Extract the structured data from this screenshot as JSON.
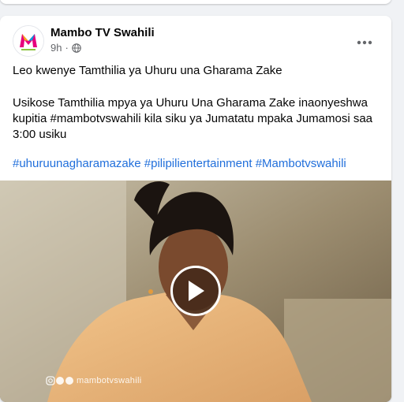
{
  "post": {
    "author": "Mambo TV Swahili",
    "time": "9h",
    "separator": "·",
    "avatar_icon": "mambo-tv-logo",
    "privacy_icon": "globe-icon",
    "menu_icon": "more-horizontal-icon",
    "lines": {
      "intro": "Leo kwenye Tamthilia ya Uhuru una Gharama Zake",
      "body": "Usikose Tamthilia mpya ya Uhuru Una Gharama Zake inaonyeshwa kupitia #mambotvswahili kila siku ya Jumatatu mpaka Jumamosi saa 3:00 usiku",
      "hashtags": "#uhuruunagharamazake #pilipilientertainment #Mambotvswahili"
    },
    "video": {
      "watermark": "mambotvswahili",
      "play_icon": "play-icon"
    }
  },
  "colors": {
    "link": "#216fdb",
    "secondary_text": "#65676b",
    "background": "#f0f2f5"
  }
}
